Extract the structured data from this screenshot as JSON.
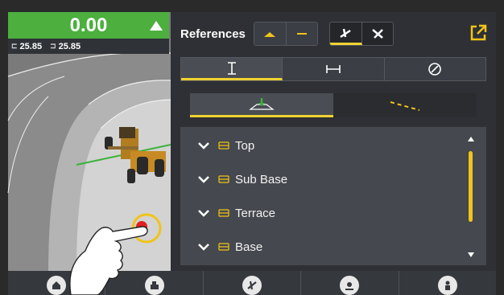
{
  "cutfill": {
    "value": "0.00"
  },
  "elevations": {
    "left": "25.85",
    "right": "25.85"
  },
  "panel": {
    "title": "References",
    "header_toggle_1": [
      "surface-icon",
      "line-icon"
    ],
    "header_toggle_2": [
      "blade-up-icon",
      "blade-cross-icon"
    ],
    "tabs": [
      "vertical-offset-icon",
      "horizontal-offset-icon",
      "slope-icon"
    ],
    "sub_toggle": [
      "surface-reference-icon",
      "line-reference-icon"
    ],
    "items": [
      {
        "label": "Top"
      },
      {
        "label": "Sub Base"
      },
      {
        "label": "Terrace"
      },
      {
        "label": "Base"
      }
    ]
  },
  "toolbar": [
    "home-icon",
    "machine-icon",
    "references-icon",
    "location-icon",
    "operator-icon"
  ],
  "colors": {
    "accent": "#f0d230",
    "cutfill": "#4caf3e",
    "panel": "#2e3035",
    "list": "#45484e"
  }
}
